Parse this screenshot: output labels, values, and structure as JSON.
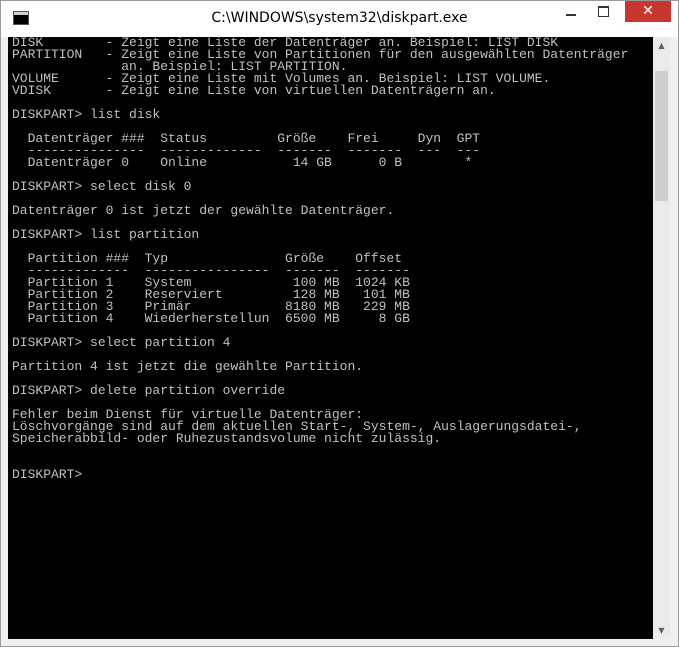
{
  "window": {
    "title": "C:\\WINDOWS\\system32\\diskpart.exe",
    "minimize_glyph": "",
    "maximize_glyph": "",
    "close_glyph": "✕"
  },
  "scrollbar": {
    "up_glyph": "▲",
    "down_glyph": "▼"
  },
  "console": {
    "lines": [
      "DISK        - Zeigt eine Liste der Datenträger an. Beispiel: LIST DISK",
      "PARTITION   - Zeigt eine Liste von Partitionen für den ausgewählten Datenträger",
      "              an. Beispiel: LIST PARTITION.",
      "VOLUME      - Zeigt eine Liste mit Volumes an. Beispiel: LIST VOLUME.",
      "VDISK       - Zeigt eine Liste von virtuellen Datenträgern an.",
      "",
      "DISKPART> list disk",
      "",
      "  Datenträger ###  Status         Größe    Frei     Dyn  GPT",
      "  ---------------  -------------  -------  -------  ---  ---",
      "  Datenträger 0    Online           14 GB      0 B        *",
      "",
      "DISKPART> select disk 0",
      "",
      "Datenträger 0 ist jetzt der gewählte Datenträger.",
      "",
      "DISKPART> list partition",
      "",
      "  Partition ###  Typ               Größe    Offset",
      "  -------------  ----------------  -------  -------",
      "  Partition 1    System             100 MB  1024 KB",
      "  Partition 2    Reserviert         128 MB   101 MB",
      "  Partition 3    Primär            8180 MB   229 MB",
      "  Partition 4    Wiederherstellun  6500 MB     8 GB",
      "",
      "DISKPART> select partition 4",
      "",
      "Partition 4 ist jetzt die gewählte Partition.",
      "",
      "DISKPART> delete partition override",
      "",
      "Fehler beim Dienst für virtuelle Datenträger:",
      "Löschvorgänge sind auf dem aktuellen Start-, System-, Auslagerungsdatei-,",
      "Speicherabbild- oder Ruhezustandsvolume nicht zulässig.",
      "",
      "",
      "DISKPART> "
    ]
  }
}
